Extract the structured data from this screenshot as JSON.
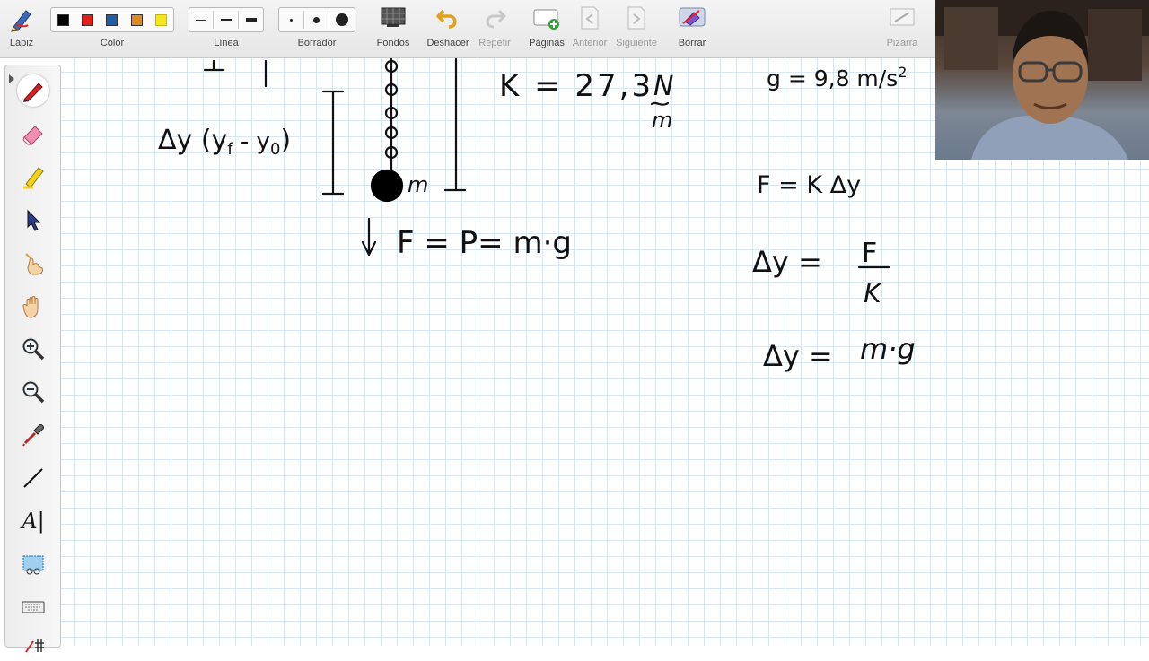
{
  "toolbar": {
    "pencil_label": "Lápiz",
    "color_label": "Color",
    "line_label": "Línea",
    "eraser_label": "Borrador",
    "backgrounds_label": "Fondos",
    "undo_label": "Deshacer",
    "redo_label": "Repetir",
    "pages_label": "Páginas",
    "previous_label": "Anterior",
    "next_label": "Siguiente",
    "clear_label": "Borrar",
    "whiteboard_label": "Pizarra",
    "colors": [
      "#000000",
      "#e0201b",
      "#1f5fa8",
      "#e08a1e",
      "#f4e61c"
    ]
  },
  "side_tools": [
    {
      "name": "pen-icon"
    },
    {
      "name": "eraser-icon"
    },
    {
      "name": "highlighter-icon"
    },
    {
      "name": "pointer-arrow-icon"
    },
    {
      "name": "laser-hand-icon"
    },
    {
      "name": "pan-hand-icon"
    },
    {
      "name": "zoom-in-icon"
    },
    {
      "name": "zoom-out-icon"
    },
    {
      "name": "eyedropper-icon"
    },
    {
      "name": "line-tool-icon"
    },
    {
      "name": "text-tool-icon"
    },
    {
      "name": "screenshot-icon"
    },
    {
      "name": "keyboard-icon"
    },
    {
      "name": "more-tools-icon"
    }
  ],
  "board": {
    "spring_constant": "K = 27,3",
    "spring_units_num": "N",
    "spring_units_den": "m",
    "gravity": "g = 9,8 m/s",
    "gravity_exp": "2",
    "delta_y_label": "Δy (y",
    "delta_y_sub_f": "f",
    "delta_y_minus": " - y",
    "delta_y_sub_0": "0",
    "delta_y_close": ")",
    "mass_label": "m",
    "force_eq": "F = P= m·g",
    "hooke_law": "F = K Δy",
    "delta_eq_left": "Δy =",
    "frac_num": "F",
    "frac_den": "K",
    "delta_eq2_left": "Δy =",
    "delta_eq2_right": "m·g",
    "text_tool_glyph": "A"
  }
}
